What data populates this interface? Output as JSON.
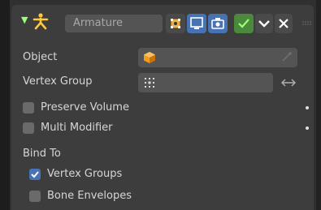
{
  "header": {
    "modifier_name": "Armature",
    "icons": {
      "expand": "triangle-down-icon",
      "modifier_type": "armature-modifier-icon",
      "edit_mode": "edit-mode-icon",
      "viewport": "viewport-display-icon",
      "render": "render-icon",
      "apply": "checkmark-icon",
      "menu": "chevron-down-icon",
      "delete": "close-icon",
      "drag": "drag-grip-icon"
    }
  },
  "fields": {
    "object_label": "Object",
    "vertex_group_label": "Vertex Group"
  },
  "options": {
    "preserve_volume": {
      "label": "Preserve Volume",
      "checked": false
    },
    "multi_modifier": {
      "label": "Multi Modifier",
      "checked": false
    }
  },
  "bind_to": {
    "label": "Bind To",
    "vertex_groups": {
      "label": "Vertex Groups",
      "checked": true
    },
    "bone_envelopes": {
      "label": "Bone Envelopes",
      "checked": false
    }
  },
  "colors": {
    "panel_bg": "#3d3d3d",
    "field_bg": "#545454",
    "accent_blue": "#4772b3",
    "accent_green": "#4b8a3d",
    "armature_yellow": "#ffc83d"
  }
}
